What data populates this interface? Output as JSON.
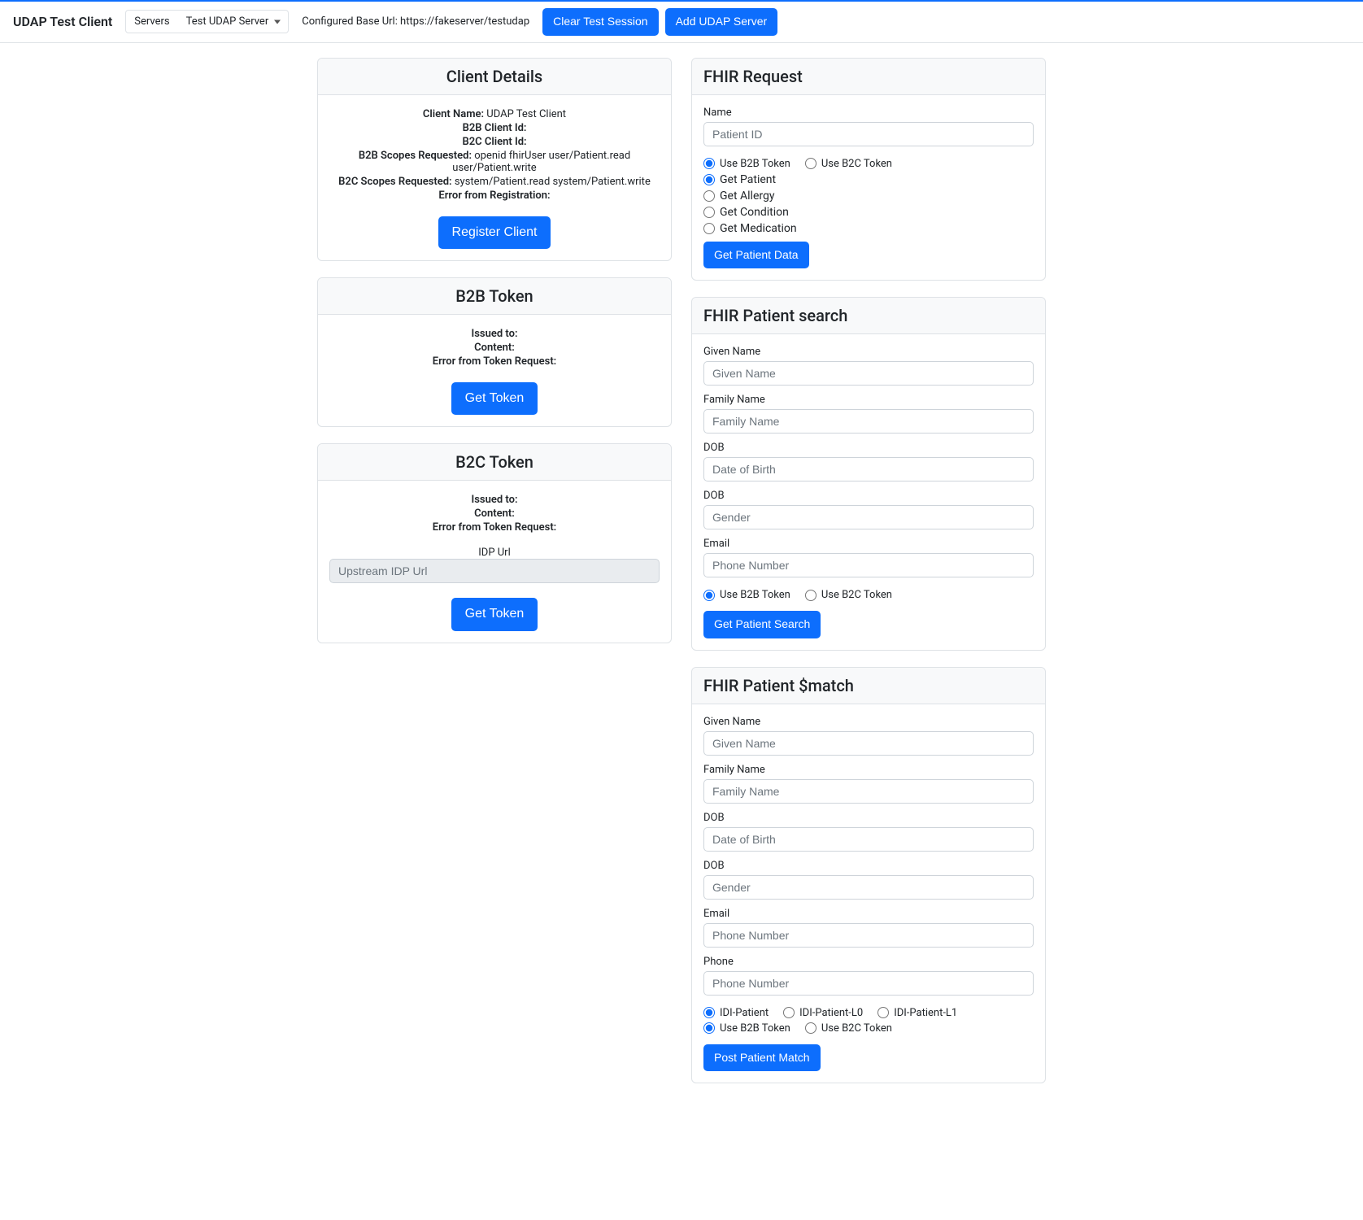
{
  "header": {
    "app_title": "UDAP Test Client",
    "servers_label": "Servers",
    "selected_server": "Test UDAP Server",
    "base_url_label": "Configured Base Url: https://fakeserver/testudap",
    "clear_session_label": "Clear Test Session",
    "add_server_label": "Add UDAP Server"
  },
  "client_details": {
    "title": "Client Details",
    "client_name_label": "Client Name:",
    "client_name_value": "UDAP Test Client",
    "b2b_client_id_label": "B2B Client Id:",
    "b2b_client_id_value": "",
    "b2c_client_id_label": "B2C Client Id:",
    "b2c_client_id_value": "",
    "b2b_scopes_label": "B2B Scopes Requested:",
    "b2b_scopes_value": "openid fhirUser user/Patient.read user/Patient.write",
    "b2c_scopes_label": "B2C Scopes Requested:",
    "b2c_scopes_value": "system/Patient.read system/Patient.write",
    "error_label": "Error from Registration:",
    "error_value": "",
    "register_button": "Register Client"
  },
  "b2b_token": {
    "title": "B2B Token",
    "issued_to_label": "Issued to:",
    "issued_to_value": "",
    "content_label": "Content:",
    "content_value": "",
    "error_label": "Error from Token Request:",
    "error_value": "",
    "get_token_button": "Get Token"
  },
  "b2c_token": {
    "title": "B2C Token",
    "issued_to_label": "Issued to:",
    "issued_to_value": "",
    "content_label": "Content:",
    "content_value": "",
    "error_label": "Error from Token Request:",
    "error_value": "",
    "idp_url_label": "IDP Url",
    "idp_url_placeholder": "Upstream IDP Url",
    "get_token_button": "Get Token"
  },
  "fhir_request": {
    "title": "FHIR Request",
    "name_label": "Name",
    "name_placeholder": "Patient ID",
    "use_b2b": "Use B2B Token",
    "use_b2c": "Use B2C Token",
    "get_patient": "Get Patient",
    "get_allergy": "Get Allergy",
    "get_condition": "Get Condition",
    "get_medication": "Get Medication",
    "button": "Get Patient Data"
  },
  "fhir_search": {
    "title": "FHIR Patient search",
    "given_label": "Given Name",
    "given_placeholder": "Given Name",
    "family_label": "Family Name",
    "family_placeholder": "Family Name",
    "dob1_label": "DOB",
    "dob1_placeholder": "Date of Birth",
    "dob2_label": "DOB",
    "dob2_placeholder": "Gender",
    "email_label": "Email",
    "email_placeholder": "Phone Number",
    "use_b2b": "Use B2B Token",
    "use_b2c": "Use B2C Token",
    "button": "Get Patient Search"
  },
  "fhir_match": {
    "title": "FHIR Patient $match",
    "given_label": "Given Name",
    "given_placeholder": "Given Name",
    "family_label": "Family Name",
    "family_placeholder": "Family Name",
    "dob1_label": "DOB",
    "dob1_placeholder": "Date of Birth",
    "dob2_label": "DOB",
    "dob2_placeholder": "Gender",
    "email_label": "Email",
    "email_placeholder": "Phone Number",
    "phone_label": "Phone",
    "phone_placeholder": "Phone Number",
    "idi_patient": "IDI-Patient",
    "idi_patient_l0": "IDI-Patient-L0",
    "idi_patient_l1": "IDI-Patient-L1",
    "use_b2b": "Use B2B Token",
    "use_b2c": "Use B2C Token",
    "button": "Post Patient Match"
  }
}
